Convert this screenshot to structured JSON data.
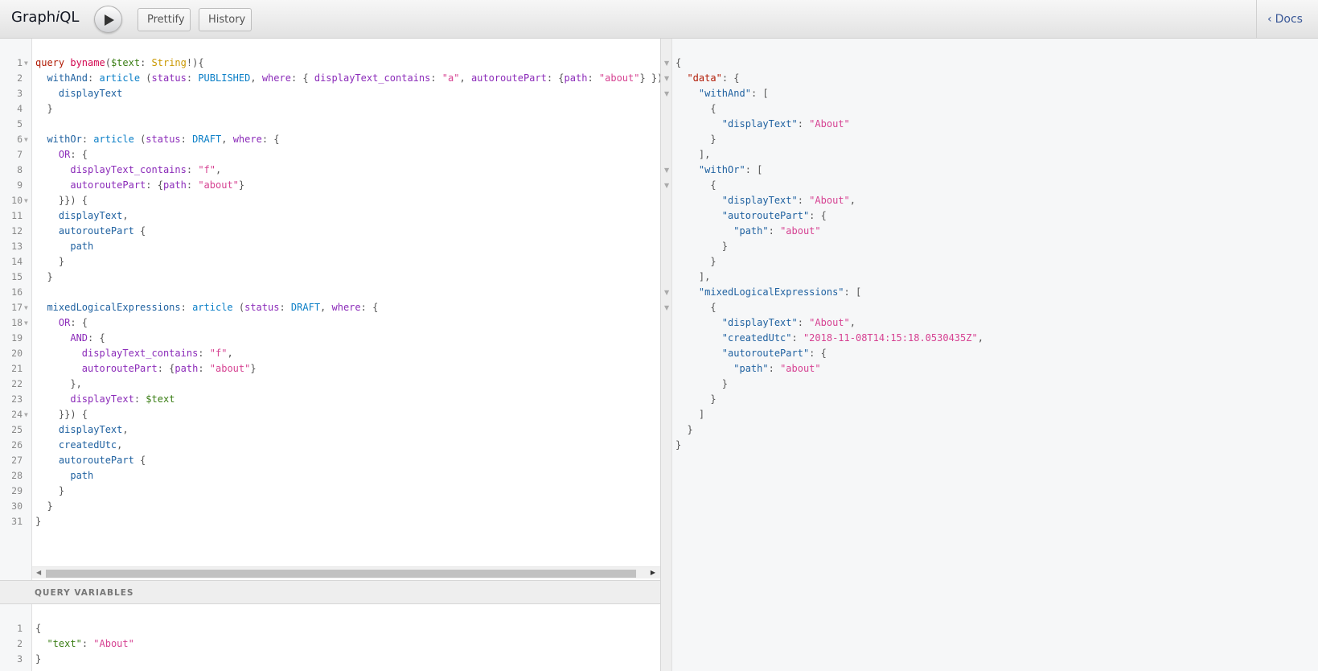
{
  "header": {
    "title_prefix": "Graph",
    "title_italic": "i",
    "title_suffix": "QL",
    "execute_icon": "play-icon",
    "prettify_label": "Prettify",
    "history_label": "History",
    "docs_label": "Docs",
    "docs_icon": "chevron-left-icon"
  },
  "query_variables": {
    "title": "QUERY VARIABLES"
  },
  "colors": {
    "keyword": "#b11a04",
    "definition": "#d2054e",
    "variable": "#397d13",
    "type": "#ca9800",
    "property": "#1f61a0",
    "attribute": "#8b2bb9",
    "string": "#d64292",
    "enum": "#0b7fc7"
  },
  "query_editor": {
    "lines": [
      [
        [
          "kw",
          "query"
        ],
        [
          "punc",
          " "
        ],
        [
          "def",
          "byname"
        ],
        [
          "punc",
          "("
        ],
        [
          "var",
          "$text"
        ],
        [
          "punc",
          ": "
        ],
        [
          "type",
          "String"
        ],
        [
          "punc",
          "!){"
        ]
      ],
      [
        [
          "punc",
          "  "
        ],
        [
          "prop",
          "withAnd"
        ],
        [
          "punc",
          ": "
        ],
        [
          "enum",
          "article"
        ],
        [
          "punc",
          " ("
        ],
        [
          "attr",
          "status"
        ],
        [
          "punc",
          ": "
        ],
        [
          "enum",
          "PUBLISHED"
        ],
        [
          "punc",
          ", "
        ],
        [
          "attr",
          "where"
        ],
        [
          "punc",
          ": { "
        ],
        [
          "attr",
          "displayText_contains"
        ],
        [
          "punc",
          ": "
        ],
        [
          "str",
          "\"a\""
        ],
        [
          "punc",
          ", "
        ],
        [
          "attr",
          "autoroutePart"
        ],
        [
          "punc",
          ": {"
        ],
        [
          "attr",
          "path"
        ],
        [
          "punc",
          ": "
        ],
        [
          "str",
          "\"about\""
        ],
        [
          "punc",
          "} }) {"
        ]
      ],
      [
        [
          "punc",
          "    "
        ],
        [
          "prop",
          "displayText"
        ]
      ],
      [
        [
          "punc",
          "  }"
        ]
      ],
      [
        [
          "punc",
          ""
        ]
      ],
      [
        [
          "punc",
          "  "
        ],
        [
          "prop",
          "withOr"
        ],
        [
          "punc",
          ": "
        ],
        [
          "enum",
          "article"
        ],
        [
          "punc",
          " ("
        ],
        [
          "attr",
          "status"
        ],
        [
          "punc",
          ": "
        ],
        [
          "enum",
          "DRAFT"
        ],
        [
          "punc",
          ", "
        ],
        [
          "attr",
          "where"
        ],
        [
          "punc",
          ": {"
        ]
      ],
      [
        [
          "punc",
          "    "
        ],
        [
          "attr",
          "OR"
        ],
        [
          "punc",
          ": {"
        ]
      ],
      [
        [
          "punc",
          "      "
        ],
        [
          "attr",
          "displayText_contains"
        ],
        [
          "punc",
          ": "
        ],
        [
          "str",
          "\"f\""
        ],
        [
          "punc",
          ","
        ]
      ],
      [
        [
          "punc",
          "      "
        ],
        [
          "attr",
          "autoroutePart"
        ],
        [
          "punc",
          ": {"
        ],
        [
          "attr",
          "path"
        ],
        [
          "punc",
          ": "
        ],
        [
          "str",
          "\"about\""
        ],
        [
          "punc",
          "}"
        ]
      ],
      [
        [
          "punc",
          "    }}) {"
        ]
      ],
      [
        [
          "punc",
          "    "
        ],
        [
          "prop",
          "displayText"
        ],
        [
          "punc",
          ","
        ]
      ],
      [
        [
          "punc",
          "    "
        ],
        [
          "prop",
          "autoroutePart"
        ],
        [
          "punc",
          " {"
        ]
      ],
      [
        [
          "punc",
          "      "
        ],
        [
          "prop",
          "path"
        ]
      ],
      [
        [
          "punc",
          "    }"
        ]
      ],
      [
        [
          "punc",
          "  }"
        ]
      ],
      [
        [
          "punc",
          ""
        ]
      ],
      [
        [
          "punc",
          "  "
        ],
        [
          "prop",
          "mixedLogicalExpressions"
        ],
        [
          "punc",
          ": "
        ],
        [
          "enum",
          "article"
        ],
        [
          "punc",
          " ("
        ],
        [
          "attr",
          "status"
        ],
        [
          "punc",
          ": "
        ],
        [
          "enum",
          "DRAFT"
        ],
        [
          "punc",
          ", "
        ],
        [
          "attr",
          "where"
        ],
        [
          "punc",
          ": {"
        ]
      ],
      [
        [
          "punc",
          "    "
        ],
        [
          "attr",
          "OR"
        ],
        [
          "punc",
          ": {"
        ]
      ],
      [
        [
          "punc",
          "      "
        ],
        [
          "attr",
          "AND"
        ],
        [
          "punc",
          ": {"
        ]
      ],
      [
        [
          "punc",
          "        "
        ],
        [
          "attr",
          "displayText_contains"
        ],
        [
          "punc",
          ": "
        ],
        [
          "str",
          "\"f\""
        ],
        [
          "punc",
          ","
        ]
      ],
      [
        [
          "punc",
          "        "
        ],
        [
          "attr",
          "autoroutePart"
        ],
        [
          "punc",
          ": {"
        ],
        [
          "attr",
          "path"
        ],
        [
          "punc",
          ": "
        ],
        [
          "str",
          "\"about\""
        ],
        [
          "punc",
          "}"
        ]
      ],
      [
        [
          "punc",
          "      },"
        ]
      ],
      [
        [
          "punc",
          "      "
        ],
        [
          "attr",
          "displayText"
        ],
        [
          "punc",
          ": "
        ],
        [
          "var",
          "$text"
        ]
      ],
      [
        [
          "punc",
          "    }}) {"
        ]
      ],
      [
        [
          "punc",
          "    "
        ],
        [
          "prop",
          "displayText"
        ],
        [
          "punc",
          ","
        ]
      ],
      [
        [
          "punc",
          "    "
        ],
        [
          "prop",
          "createdUtc"
        ],
        [
          "punc",
          ","
        ]
      ],
      [
        [
          "punc",
          "    "
        ],
        [
          "prop",
          "autoroutePart"
        ],
        [
          "punc",
          " {"
        ]
      ],
      [
        [
          "punc",
          "      "
        ],
        [
          "prop",
          "path"
        ]
      ],
      [
        [
          "punc",
          "    }"
        ]
      ],
      [
        [
          "punc",
          "  }"
        ]
      ],
      [
        [
          "punc",
          "}"
        ]
      ]
    ],
    "fold_lines": [
      1,
      6,
      10,
      17,
      18,
      24
    ]
  },
  "variables_editor": {
    "lines": [
      [
        [
          "punc",
          "{"
        ]
      ],
      [
        [
          "punc",
          "  "
        ],
        [
          "var",
          "\"text\""
        ],
        [
          "punc",
          ": "
        ],
        [
          "str",
          "\"About\""
        ]
      ],
      [
        [
          "punc",
          "}"
        ]
      ]
    ]
  },
  "result": {
    "lines": [
      [
        [
          "punc",
          "{"
        ]
      ],
      [
        [
          "punc",
          "  "
        ],
        [
          "json-data",
          "\"data\""
        ],
        [
          "punc",
          ": {"
        ]
      ],
      [
        [
          "punc",
          "    "
        ],
        [
          "json-key",
          "\"withAnd\""
        ],
        [
          "punc",
          ": ["
        ]
      ],
      [
        [
          "punc",
          "      {"
        ]
      ],
      [
        [
          "punc",
          "        "
        ],
        [
          "json-key",
          "\"displayText\""
        ],
        [
          "punc",
          ": "
        ],
        [
          "json-str",
          "\"About\""
        ]
      ],
      [
        [
          "punc",
          "      }"
        ]
      ],
      [
        [
          "punc",
          "    ],"
        ]
      ],
      [
        [
          "punc",
          "    "
        ],
        [
          "json-key",
          "\"withOr\""
        ],
        [
          "punc",
          ": ["
        ]
      ],
      [
        [
          "punc",
          "      {"
        ]
      ],
      [
        [
          "punc",
          "        "
        ],
        [
          "json-key",
          "\"displayText\""
        ],
        [
          "punc",
          ": "
        ],
        [
          "json-str",
          "\"About\""
        ],
        [
          "punc",
          ","
        ]
      ],
      [
        [
          "punc",
          "        "
        ],
        [
          "json-key",
          "\"autoroutePart\""
        ],
        [
          "punc",
          ": {"
        ]
      ],
      [
        [
          "punc",
          "          "
        ],
        [
          "json-key",
          "\"path\""
        ],
        [
          "punc",
          ": "
        ],
        [
          "json-str",
          "\"about\""
        ]
      ],
      [
        [
          "punc",
          "        }"
        ]
      ],
      [
        [
          "punc",
          "      }"
        ]
      ],
      [
        [
          "punc",
          "    ],"
        ]
      ],
      [
        [
          "punc",
          "    "
        ],
        [
          "json-key",
          "\"mixedLogicalExpressions\""
        ],
        [
          "punc",
          ": ["
        ]
      ],
      [
        [
          "punc",
          "      {"
        ]
      ],
      [
        [
          "punc",
          "        "
        ],
        [
          "json-key",
          "\"displayText\""
        ],
        [
          "punc",
          ": "
        ],
        [
          "json-str",
          "\"About\""
        ],
        [
          "punc",
          ","
        ]
      ],
      [
        [
          "punc",
          "        "
        ],
        [
          "json-key",
          "\"createdUtc\""
        ],
        [
          "punc",
          ": "
        ],
        [
          "json-str",
          "\"2018-11-08T14:15:18.0530435Z\""
        ],
        [
          "punc",
          ","
        ]
      ],
      [
        [
          "punc",
          "        "
        ],
        [
          "json-key",
          "\"autoroutePart\""
        ],
        [
          "punc",
          ": {"
        ]
      ],
      [
        [
          "punc",
          "          "
        ],
        [
          "json-key",
          "\"path\""
        ],
        [
          "punc",
          ": "
        ],
        [
          "json-str",
          "\"about\""
        ]
      ],
      [
        [
          "punc",
          "        }"
        ]
      ],
      [
        [
          "punc",
          "      }"
        ]
      ],
      [
        [
          "punc",
          "    ]"
        ]
      ],
      [
        [
          "punc",
          "  }"
        ]
      ],
      [
        [
          "punc",
          "}"
        ]
      ]
    ],
    "fold_lines": [
      1,
      2,
      3,
      8,
      9,
      16,
      17
    ]
  }
}
